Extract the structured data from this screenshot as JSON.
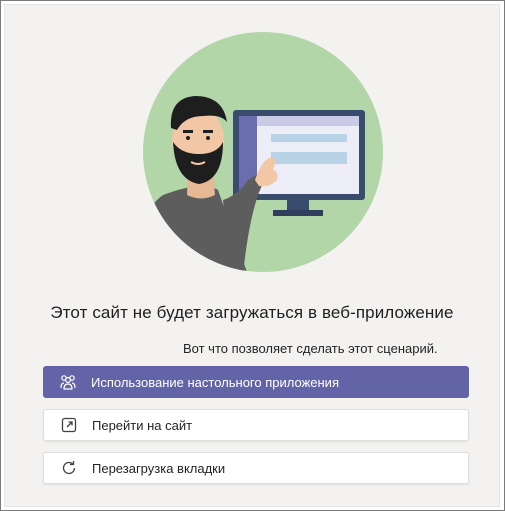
{
  "message": {
    "title": "Этот сайт не будет загружаться в веб-приложение",
    "subtitle": "Вот что позволяет сделать этот сценарий."
  },
  "actions": [
    {
      "label": "Использование настольного приложения",
      "icon": "teams-app-icon",
      "style": "primary"
    },
    {
      "label": "Перейти на сайт",
      "icon": "open-external-icon",
      "style": "secondary"
    },
    {
      "label": "Перезагрузка вкладки",
      "icon": "reload-icon",
      "style": "secondary"
    }
  ],
  "colors": {
    "accent": "#6264a7",
    "panel_background": "#f3f2f1",
    "illustration_circle": "#b3d6a8"
  }
}
